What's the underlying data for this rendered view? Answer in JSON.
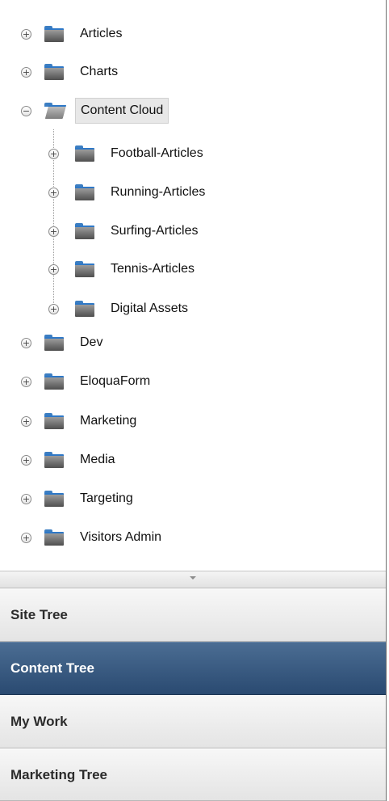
{
  "tree": {
    "items": [
      {
        "label": "Articles",
        "toggle": "+"
      },
      {
        "label": "Charts",
        "toggle": "+"
      },
      {
        "label": "Content Cloud",
        "toggle": "−"
      },
      {
        "label": "Football-Articles",
        "toggle": "+"
      },
      {
        "label": "Running-Articles",
        "toggle": "+"
      },
      {
        "label": "Surfing-Articles",
        "toggle": "+"
      },
      {
        "label": "Tennis-Articles",
        "toggle": "+"
      },
      {
        "label": "Digital Assets",
        "toggle": "+"
      },
      {
        "label": "Dev",
        "toggle": "+"
      },
      {
        "label": "EloquaForm",
        "toggle": "+"
      },
      {
        "label": "Marketing",
        "toggle": "+"
      },
      {
        "label": "Media",
        "toggle": "+"
      },
      {
        "label": "Targeting",
        "toggle": "+"
      },
      {
        "label": "Visitors Admin",
        "toggle": "+"
      }
    ]
  },
  "panels": {
    "site_tree": "Site Tree",
    "content_tree": "Content Tree",
    "my_work": "My Work",
    "marketing_tree": "Marketing Tree"
  },
  "colors": {
    "active_tab": "#2e4f76",
    "folder_tab": "#3c7ec2"
  }
}
